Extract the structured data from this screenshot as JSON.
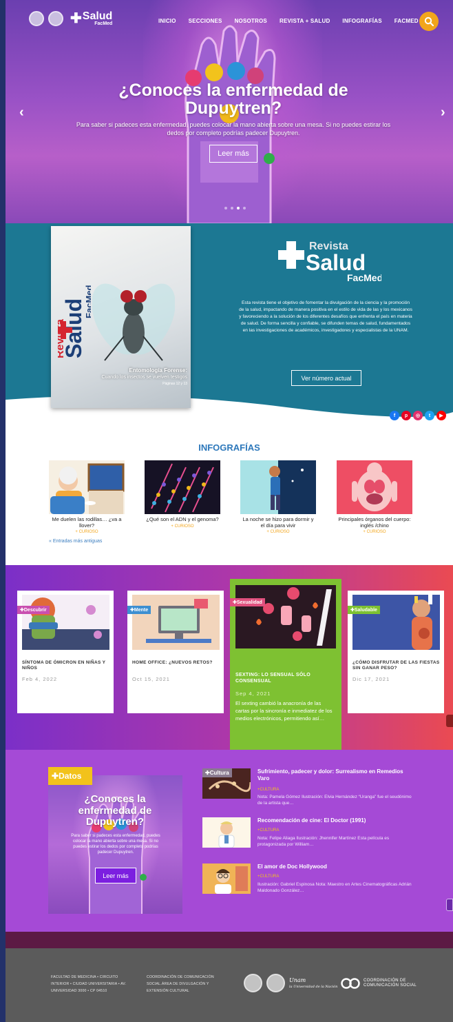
{
  "nav": {
    "brand": "Salud",
    "brand_sub": "FacMed",
    "menu": [
      "INICIO",
      "SECCIONES",
      "NOSOTROS",
      "REVISTA + SALUD",
      "INFOGRAFÍAS",
      "FACMED"
    ]
  },
  "hero": {
    "title": "¿Conoces la enfermedad de Dupuytren?",
    "subtitle": "Para saber si padeces esta enfermedad, puedes colocar la mano abierta sobre una mesa. Si no puedes estirar los dedos por completo podrías padecer Dupuytren.",
    "button": "Leer más",
    "prev": "‹",
    "next": "›",
    "slides_count": 4,
    "active_slide": 3
  },
  "revista": {
    "cover_word1": "Revista",
    "cover_word2": "Salud",
    "cover_word3": "FacMed",
    "cover_headline": "Entomología Forense:",
    "cover_sub": "Cuando los insectos se vuelven testigos",
    "cover_pages": "Páginas 12 y 13",
    "logo_top": "Revista",
    "logo_main": "Salud",
    "logo_sub": "FacMed",
    "description": "Esta revista tiene el objetivo de fomentar la divulgación de la ciencia y la promoción de la salud, impactando de manera positiva en el estilo de vida de las y los mexicanos y favoreciendo a la solución de los diferentes desafíos que enfrenta el país en materia de salud. De forma sencilla y confiable, se difunden temas de salud, fundamentados en las investigaciones de académicos, investigadores y especialistas de la UNAM.",
    "button": "Ver número actual"
  },
  "social": [
    {
      "icon": "facebook-icon",
      "glyph": "f",
      "color": "#1877f2"
    },
    {
      "icon": "pinterest-icon",
      "glyph": "p",
      "color": "#e60023"
    },
    {
      "icon": "instagram-icon",
      "glyph": "◎",
      "color": "#e1306c"
    },
    {
      "icon": "twitter-icon",
      "glyph": "t",
      "color": "#1da1f2"
    },
    {
      "icon": "youtube-icon",
      "glyph": "▶",
      "color": "#ff0000"
    }
  ],
  "infografias": {
    "heading": "INFOGRAFÍAS",
    "items": [
      {
        "title": "Me duelen las rodillas… ¿va a llover?",
        "category": "+ CURIOSO"
      },
      {
        "title": "¿Qué son el ADN y el genoma?",
        "category": "+ CURIOSO"
      },
      {
        "title": "La noche se hizo para dormir y el día para vivir",
        "category": "+ CURIOSO"
      },
      {
        "title": "Principales órganos del cuerpo: inglés /chino",
        "category": "+ CURIOSO"
      }
    ],
    "older": "« Entradas más antiguas"
  },
  "articles": [
    {
      "tag": "Descubrir",
      "tag_color": "#c94fb0",
      "title": "SÍNTOMA DE ÓMICRON EN NIÑAS Y NIÑOS",
      "date": "Feb 4, 2022"
    },
    {
      "tag": "Mente",
      "tag_color": "#3d8fd1",
      "title": "HOME OFFICE: ¿NUEVOS RETOS?",
      "date": "Oct 15, 2021"
    },
    {
      "tag": "Sexualidad",
      "tag_color": "#e0507e",
      "title": "SEXTING: LO SENSUAL SÓLO CONSENSUAL",
      "date": "Sep 4, 2021",
      "excerpt": "El sexting cambió la anacronía de las cartas por la sincronía e inmediatez de los medios electrónicos, permitiendo así…"
    },
    {
      "tag": "Saludable",
      "tag_color": "#7ec132",
      "title": "¿CÓMO DISFRUTAR DE LAS FIESTAS SIN GANAR PESO?",
      "date": "Dic 17, 2021"
    }
  ],
  "datos": {
    "tag": "Datos",
    "title": "¿Conoces la enfermedad de Dupuytren?",
    "subtitle": "Para saber si padeces esta enfermedad, puedes colocar la mano abierta sobre una mesa. Si no puedes estirar los dedos por completo podrías padecer Dupuytren.",
    "button": "Leer más"
  },
  "list": [
    {
      "tag": "Cultura",
      "title": "Sufrimiento, padecer y dolor: Surrealismo en Remedios Varo",
      "category": "+CULTURA",
      "excerpt": "Nota: Pamela Gómez Ilustración: Elvia Hernández “Uranga” fue el seudónimo de la artista que…"
    },
    {
      "tag": "",
      "title": "Recomendación de cine: El Doctor (1991)",
      "category": "+CULTURA",
      "excerpt": "Nota: Felipe Aliaga Ilustración: Jhennifer Martínez Esta película es protagonizada por William…"
    },
    {
      "tag": "",
      "title": "El amor de Doc Hollywood",
      "category": "+CULTURA",
      "excerpt": "Ilustración: Gabriel Espinosa Nota: Maestro en Artes Cinematográficas Adrián Maldonado González…"
    }
  ],
  "footer": {
    "address": "FACULTAD DE MEDICINA • CIRCUITO INTERIOR • CIUDAD UNIVERSITARIA • AV. UNIVERSIDAD 3000 • CP 04510",
    "coordination": "COORDINACIÓN DE COMUNICACIÓN SOCIAL.ÁREA DE DIVULGACIÓN Y EXTENSIÓN CULTURAL",
    "unam_script_1": "Unam",
    "unam_script_2": "la Universidad de la Nación",
    "cs_line1": "COORDINACIÓN DE",
    "cs_line2": "COMUNICACIÓN SOCIAL"
  }
}
